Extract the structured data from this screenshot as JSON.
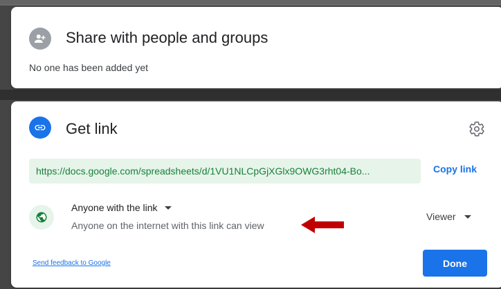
{
  "share_card": {
    "title": "Share with people and groups",
    "subtext": "No one has been added yet",
    "icon": "person-add-icon"
  },
  "link_card": {
    "title": "Get link",
    "icon": "link-icon",
    "settings_icon": "gear-icon",
    "url": "https://docs.google.com/spreadsheets/d/1VU1NLCpGjXGlx9OWG3rht04-Bo...",
    "copy_label": "Copy link",
    "access": {
      "icon": "globe-icon",
      "selected": "Anyone with the link",
      "description": "Anyone on the internet with this link can view"
    },
    "role": "Viewer",
    "feedback_label": "Send feedback to Google",
    "done_label": "Done"
  },
  "annotation": {
    "arrow_color": "#c00000"
  },
  "colors": {
    "accent": "#1a73e8",
    "url_text": "#188038",
    "url_bg": "#e6f4ea"
  }
}
